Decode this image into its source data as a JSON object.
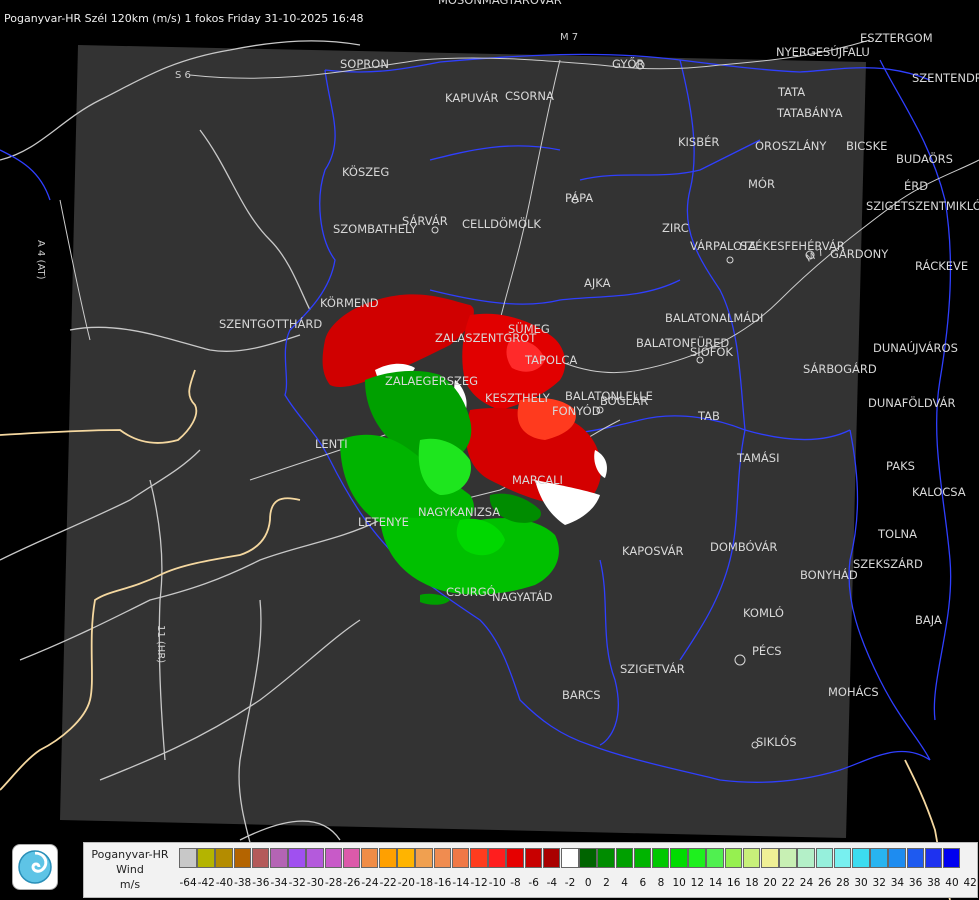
{
  "header": {
    "title": "Poganyvar-HR Szél 120km (m/s) 1 fokos Friday 31-10-2025 16:48"
  },
  "map": {
    "cities": [
      {
        "name": "MOSONMAGYARÓVÁR"
      },
      {
        "name": "SOPRON"
      },
      {
        "name": "KAPUVÁR"
      },
      {
        "name": "CSORNA"
      },
      {
        "name": "GYŐR"
      },
      {
        "name": "KÖSZEG"
      },
      {
        "name": "PÁPA"
      },
      {
        "name": "SZOMBATHELY"
      },
      {
        "name": "SÁRVÁR"
      },
      {
        "name": "CELLDÖMÖLK"
      },
      {
        "name": "ZIRC"
      },
      {
        "name": "AJKA"
      },
      {
        "name": "KÖRMEND"
      },
      {
        "name": "SZENTGOTTHÁRD"
      },
      {
        "name": "SÜMEG"
      },
      {
        "name": "ZALASZENTGRÓT"
      },
      {
        "name": "TAPOLCA"
      },
      {
        "name": "ZALAEGERSZEG"
      },
      {
        "name": "KESZTHELY"
      },
      {
        "name": "BALATONLELLE"
      },
      {
        "name": "FONYÓD"
      },
      {
        "name": "BOGLÁR"
      },
      {
        "name": "LENTI"
      },
      {
        "name": "MARCALI"
      },
      {
        "name": "LETENYE"
      },
      {
        "name": "NAGYKANIZSA"
      },
      {
        "name": "CSURGÓ"
      },
      {
        "name": "NAGYATÁD"
      },
      {
        "name": "KAPOSVÁR"
      },
      {
        "name": "DOMBÓVÁR"
      },
      {
        "name": "TAMÁSI"
      },
      {
        "name": "TAB"
      },
      {
        "name": "SIÓFOK"
      },
      {
        "name": "BALATONFÜRED"
      },
      {
        "name": "BALATONALMÁDI"
      },
      {
        "name": "VÁRPALOTA"
      },
      {
        "name": "SZÉKESFEHÉRVÁR"
      },
      {
        "name": "GÁRDONY"
      },
      {
        "name": "MÓR"
      },
      {
        "name": "KISBÉR"
      },
      {
        "name": "OROSZLÁNY"
      },
      {
        "name": "BICSKE"
      },
      {
        "name": "TATA"
      },
      {
        "name": "TATABÁNYA"
      },
      {
        "name": "ESZTERGOM"
      },
      {
        "name": "NYERGESÚJFALU"
      },
      {
        "name": "SZENTENDRE"
      },
      {
        "name": "BUDAÖRS"
      },
      {
        "name": "ÉRD"
      },
      {
        "name": "SZIGETSZENTMIKLÓS"
      },
      {
        "name": "RÁCKEVE"
      },
      {
        "name": "DUNAÚJVÁROS"
      },
      {
        "name": "SÁRBOGÁRD"
      },
      {
        "name": "DUNAFÖLDVÁR"
      },
      {
        "name": "PAKS"
      },
      {
        "name": "KALOCSA"
      },
      {
        "name": "TOLNA"
      },
      {
        "name": "SZEKSZÁRD"
      },
      {
        "name": "BONYHÁD"
      },
      {
        "name": "KOMLÓ"
      },
      {
        "name": "PÉCS"
      },
      {
        "name": "BAJA"
      },
      {
        "name": "MOHÁCS"
      },
      {
        "name": "SZIGETVÁR"
      },
      {
        "name": "BARCS"
      },
      {
        "name": "SIKLÓS"
      }
    ],
    "road_labels": [
      "S 6",
      "A 4 (AT)",
      "11 (HR)",
      "M 7",
      "M 7"
    ]
  },
  "legend": {
    "title_lines": [
      "Poganyvar-HR",
      "Wind",
      "m/s"
    ],
    "colors": [
      "#c8c8c8",
      "#b4b400",
      "#b48c00",
      "#b46400",
      "#b45a5a",
      "#b464b4",
      "#a050f0",
      "#b45adc",
      "#c85ac8",
      "#dc5aaa",
      "#f08c46",
      "#ffa000",
      "#ffb400",
      "#f0a050",
      "#f08c50",
      "#f07846",
      "#ff3c1e",
      "#ff1e1e",
      "#e60000",
      "#c80000",
      "#aa0000",
      "#ffffff",
      "#006400",
      "#008c00",
      "#00a000",
      "#00b400",
      "#00c800",
      "#00dc00",
      "#1ef01e",
      "#50f050",
      "#96f050",
      "#c8f07a",
      "#f0f096",
      "#c8f0b4",
      "#b4f0c8",
      "#96f0dc",
      "#78f0f0",
      "#3cdcf0",
      "#28b4f0",
      "#1e8cf0",
      "#1e5af0",
      "#1e32f0",
      "#0000f0"
    ],
    "ticks": [
      "-64",
      "-42",
      "-40",
      "-38",
      "-36",
      "-34",
      "-32",
      "-30",
      "-28",
      "-26",
      "-24",
      "-22",
      "-20",
      "-18",
      "-16",
      "-14",
      "-12",
      "-10",
      "-8",
      "-6",
      "-4",
      "-2",
      "0",
      "2",
      "4",
      "6",
      "8",
      "10",
      "12",
      "14",
      "16",
      "18",
      "20",
      "22",
      "24",
      "26",
      "28",
      "30",
      "32",
      "34",
      "36",
      "38",
      "40",
      "42"
    ]
  }
}
